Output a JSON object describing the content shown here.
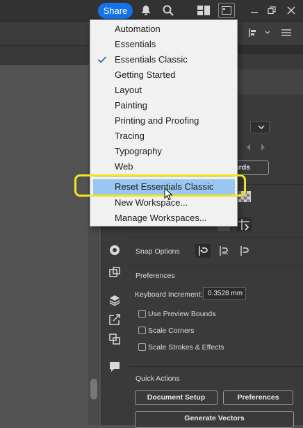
{
  "topbar": {
    "share_label": "Share",
    "icons": [
      "bell-icon",
      "search-icon",
      "arrange-documents-icon",
      "workspace-switcher-icon",
      "minimize-icon",
      "restore-icon",
      "close-icon"
    ]
  },
  "workspace_menu": {
    "items": [
      {
        "label": "Automation",
        "checked": false
      },
      {
        "label": "Essentials",
        "checked": false
      },
      {
        "label": "Essentials Classic",
        "checked": true
      },
      {
        "label": "Getting Started",
        "checked": false
      },
      {
        "label": "Layout",
        "checked": false
      },
      {
        "label": "Painting",
        "checked": false
      },
      {
        "label": "Printing and Proofing",
        "checked": false
      },
      {
        "label": "Tracing",
        "checked": false
      },
      {
        "label": "Typography",
        "checked": false
      },
      {
        "label": "Web",
        "checked": false
      }
    ],
    "actions": [
      {
        "label": "Reset Essentials Classic",
        "highlighted": true
      },
      {
        "label": "New Workspace...",
        "highlighted": false
      },
      {
        "label": "Manage Workspaces...",
        "highlighted": false
      }
    ]
  },
  "properties_panel": {
    "partial_button_label": "ards",
    "snap_options_label": "Snap Options",
    "preferences_heading": "Preferences",
    "keyboard_increment_label": "Keyboard Increment:",
    "keyboard_increment_value": "0.3528 mm",
    "checkboxes": [
      {
        "label": "Use Preview Bounds",
        "checked": false
      },
      {
        "label": "Scale Corners",
        "checked": false
      },
      {
        "label": "Scale Strokes & Effects",
        "checked": false
      }
    ],
    "quick_actions_heading": "Quick Actions",
    "document_setup_label": "Document Setup",
    "preferences_button_label": "Preferences",
    "generate_vectors_label": "Generate Vectors"
  },
  "colors": {
    "share_blue": "#1473e6",
    "menu_highlight": "#99c7f2",
    "annotation_yellow": "#f0e61e",
    "panel_bg": "#3a3a3a"
  }
}
